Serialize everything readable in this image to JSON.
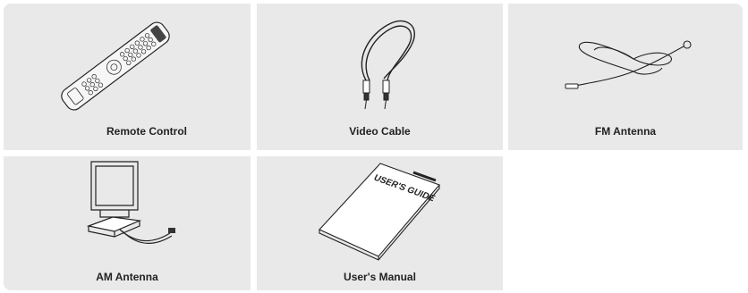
{
  "accessories": [
    {
      "label": "Remote Control",
      "icon": "remote-control-icon"
    },
    {
      "label": "Video Cable",
      "icon": "video-cable-icon"
    },
    {
      "label": "FM Antenna",
      "icon": "fm-antenna-icon"
    },
    {
      "label": "AM Antenna",
      "icon": "am-antenna-icon"
    },
    {
      "label": "User's Manual",
      "icon": "users-manual-icon",
      "cover_text": "USER'S GUIDE"
    }
  ],
  "colors": {
    "cell_background": "#e9e9e9",
    "line": "#222222"
  }
}
